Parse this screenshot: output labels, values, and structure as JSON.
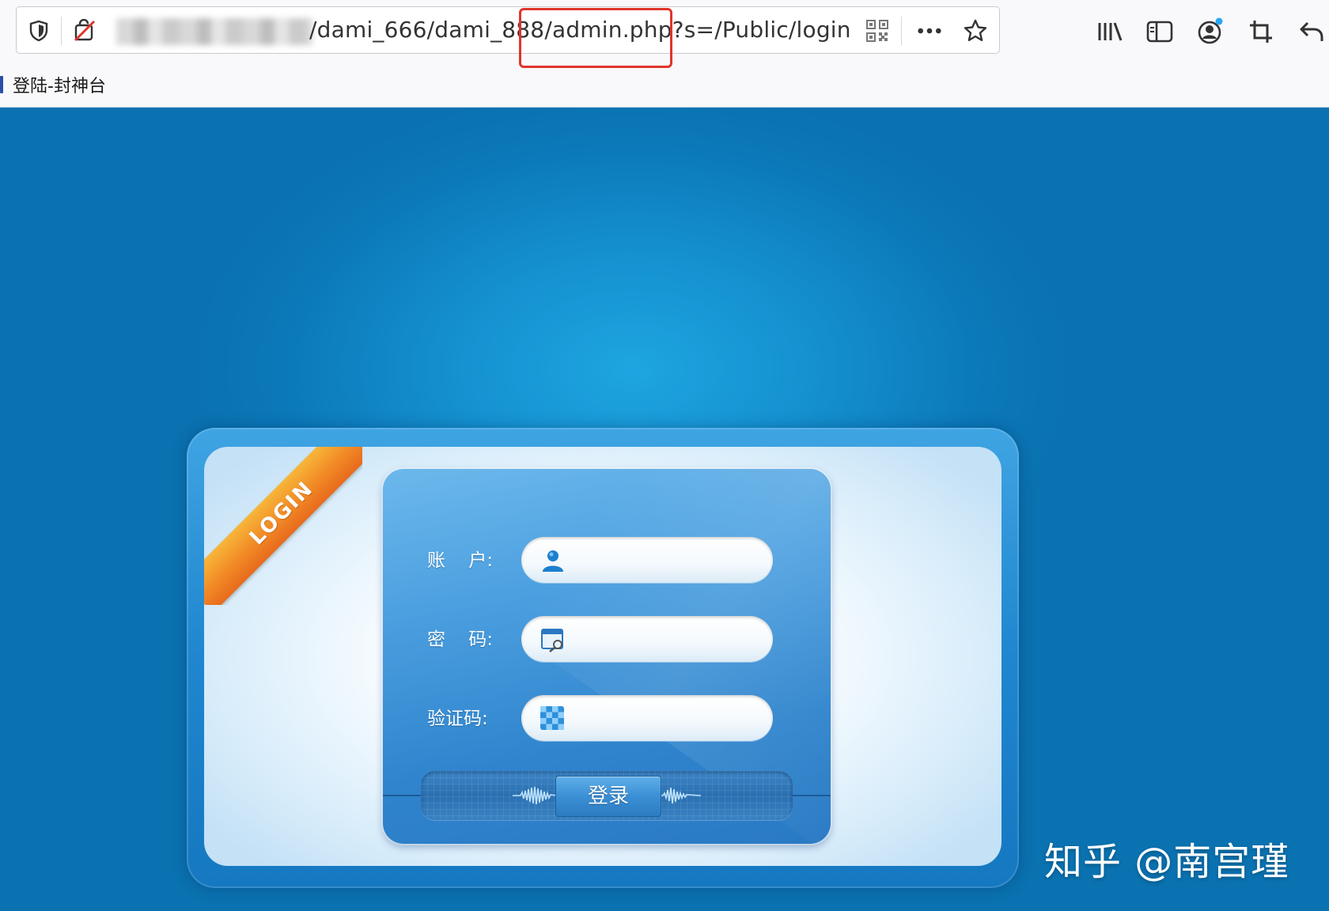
{
  "browser": {
    "url": "/dami_666/dami_888/admin.php?s=/Public/login",
    "bookmark_label": "登陆-封神台"
  },
  "icons": {
    "tracking": "shield-icon",
    "permissions": "blocked-permission-icon",
    "qr": "qr-code-icon",
    "menu": "more-dots-icon",
    "star": "bookmark-star-icon",
    "library": "library-icon",
    "sidebar": "sidebar-icon",
    "account": "account-icon",
    "crop": "screenshot-crop-icon",
    "back": "undo-back-icon"
  },
  "login": {
    "ribbon": "LOGIN",
    "fields": [
      {
        "label": "账    户:",
        "icon": "user-icon",
        "value": ""
      },
      {
        "label": "密    码:",
        "icon": "password-icon",
        "value": ""
      },
      {
        "label": "验证码:",
        "icon": "captcha-icon",
        "value": ""
      }
    ],
    "submit_label": "登录"
  },
  "watermark": "知乎 @南宫瑾",
  "colors": {
    "page_bg": "#0b78b8",
    "highlight": "#e0352b",
    "ribbon": "#f28a26"
  }
}
